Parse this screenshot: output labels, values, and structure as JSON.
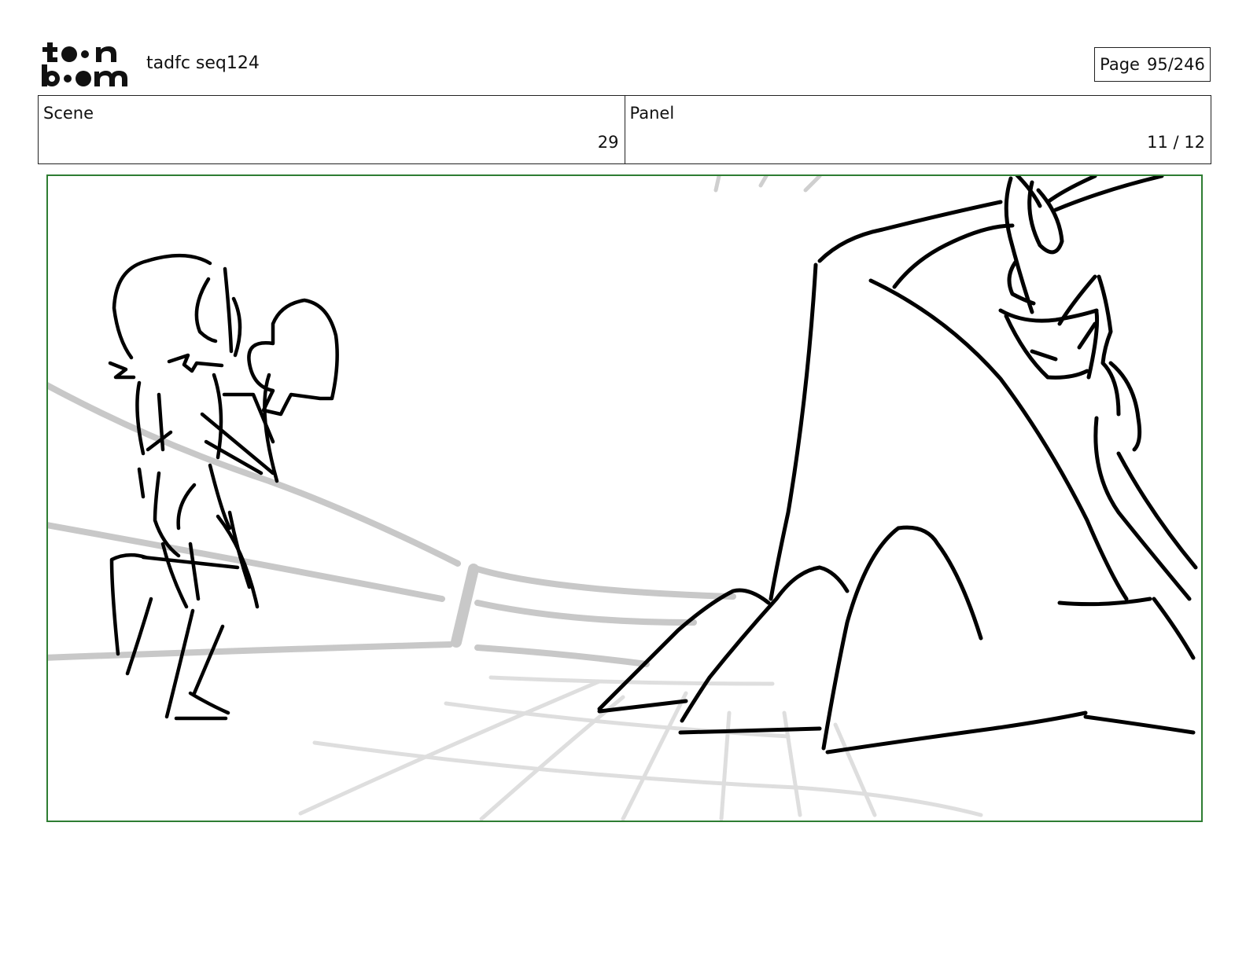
{
  "header": {
    "logo_text": "toon boom",
    "project_title": "tadfc seq124",
    "page_label": "Page",
    "page_value": "95/246"
  },
  "info": {
    "scene_label": "Scene",
    "scene_value": "29",
    "panel_label": "Panel",
    "panel_value": "11 / 12"
  },
  "colors": {
    "frame_border": "#2e7d32",
    "sketch_ink": "#000000",
    "ring_ropes": "#c8c8c8",
    "floor_grid": "#dedede"
  }
}
